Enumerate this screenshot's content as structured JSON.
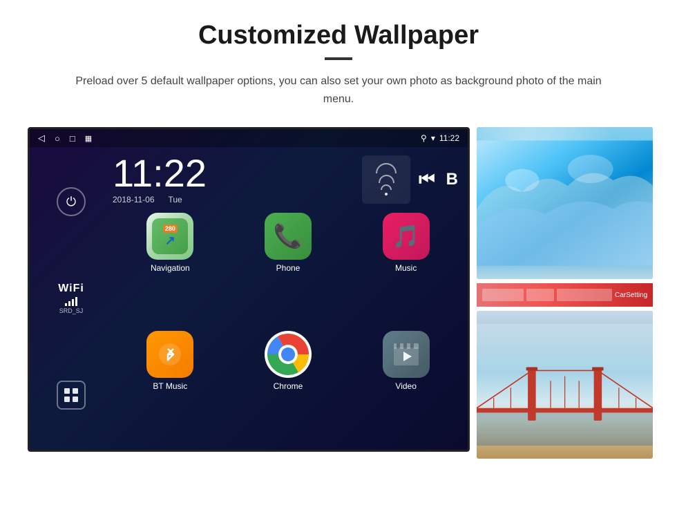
{
  "header": {
    "title": "Customized Wallpaper",
    "subtitle": "Preload over 5 default wallpaper options, you can also set your own photo as background photo of the main menu."
  },
  "status_bar": {
    "time": "11:22",
    "nav_back": "◁",
    "nav_home": "○",
    "nav_recent": "□",
    "nav_screenshot": "▦",
    "location_icon": "⚲",
    "wifi_icon": "▾",
    "time_label": "11:22"
  },
  "clock": {
    "time": "11:22",
    "date": "2018-11-06",
    "day": "Tue"
  },
  "sidebar": {
    "power_icon": "⏻",
    "wifi_label": "WiFi",
    "wifi_ssid": "SRD_SJ",
    "apps_icon": "⊞"
  },
  "apps": [
    {
      "id": "navigation",
      "label": "Navigation",
      "road_num": "280",
      "type": "nav"
    },
    {
      "id": "phone",
      "label": "Phone",
      "type": "phone"
    },
    {
      "id": "music",
      "label": "Music",
      "type": "music"
    },
    {
      "id": "bt_music",
      "label": "BT Music",
      "type": "bt"
    },
    {
      "id": "chrome",
      "label": "Chrome",
      "type": "chrome"
    },
    {
      "id": "video",
      "label": "Video",
      "type": "video"
    }
  ],
  "carsetting_label": "CarSetting"
}
